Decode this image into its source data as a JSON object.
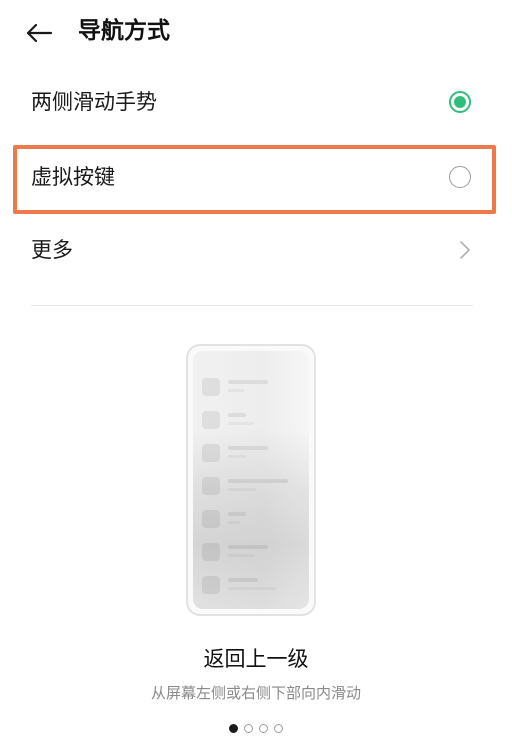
{
  "header": {
    "title": "导航方式",
    "back_icon": "arrow-left-icon"
  },
  "options": [
    {
      "label": "两侧滑动手势",
      "selected": true
    },
    {
      "label": "虚拟按键",
      "selected": false,
      "highlighted": true
    },
    {
      "label": "更多",
      "type": "link"
    }
  ],
  "illustration": {
    "title": "返回上一级",
    "subtitle": "从屏幕左侧或右侧下部向内滑动"
  },
  "pager": {
    "count": 4,
    "active_index": 0
  },
  "colors": {
    "accent": "#2fbf7a",
    "highlight_border": "#ee7a4c"
  }
}
